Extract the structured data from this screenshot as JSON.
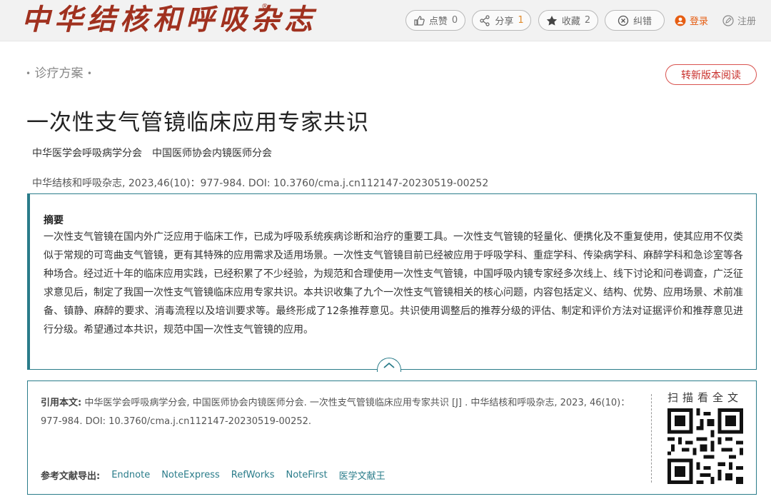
{
  "header": {
    "logo_text": "中华结核和呼吸杂志",
    "logo_mark": "®",
    "like": {
      "label": "点赞",
      "count": "0"
    },
    "share": {
      "label": "分享",
      "count": "1"
    },
    "favorite": {
      "label": "收藏",
      "count": "2"
    },
    "correct": {
      "label": "纠错"
    },
    "login": "登录",
    "register": "注册"
  },
  "article": {
    "category": "诊疗方案",
    "new_version_button": "转新版本阅读",
    "title": "一次性支气管镜临床应用专家共识",
    "authors": [
      "中华医学会呼吸病学分会",
      "中国医师协会内镜医师分会"
    ],
    "citation_line": "中华结核和呼吸杂志, 2023,46(10)：977-984. DOI: 10.3760/cma.j.cn112147-20230519-00252"
  },
  "abstract": {
    "heading": "摘要",
    "text": "一次性支气管镜在国内外广泛应用于临床工作，已成为呼吸系统疾病诊断和治疗的重要工具。一次性支气管镜的轻量化、便携化及不重复使用，使其应用不仅类似于常规的可弯曲支气管镜，更有其特殊的应用需求及适用场景。一次性支气管镜目前已经被应用于呼吸学科、重症学科、传染病学科、麻醉学科和急诊室等各种场合。经过近十年的临床应用实践，已经积累了不少经验，为规范和合理使用一次性支气管镜，中国呼吸内镜专家经多次线上、线下讨论和问卷调查，广泛征求意见后，制定了我国一次性支气管镜临床应用专家共识。本共识收集了九个一次性支气管镜相关的核心问题，内容包括定义、结构、优势、应用场景、术前准备、镇静、麻醉的要求、消毒流程以及培训要求等。最终形成了12条推荐意见。共识使用调整后的推荐分级的评估、制定和评价方法对证据评价和推荐意见进行分级。希望通过本共识，规范中国一次性支气管镜的应用。"
  },
  "cite": {
    "label": "引用本文:",
    "text": "中华医学会呼吸病学分会, 中国医师协会内镜医师分会. 一次性支气管镜临床应用专家共识 [J] . 中华结核和呼吸杂志, 2023, 46(10)：977-984. DOI: 10.3760/cma.j.cn112147-20230519-00252.",
    "export_label": "参考文献导出:",
    "export_links": [
      "Endnote",
      "NoteExpress",
      "RefWorks",
      "NoteFirst",
      "医学文献王"
    ],
    "scan_label": "扫描看全文"
  },
  "colors": {
    "teal": "#2a7c8a",
    "brand_red": "#a0311f",
    "login_orange": "#e65d12"
  }
}
